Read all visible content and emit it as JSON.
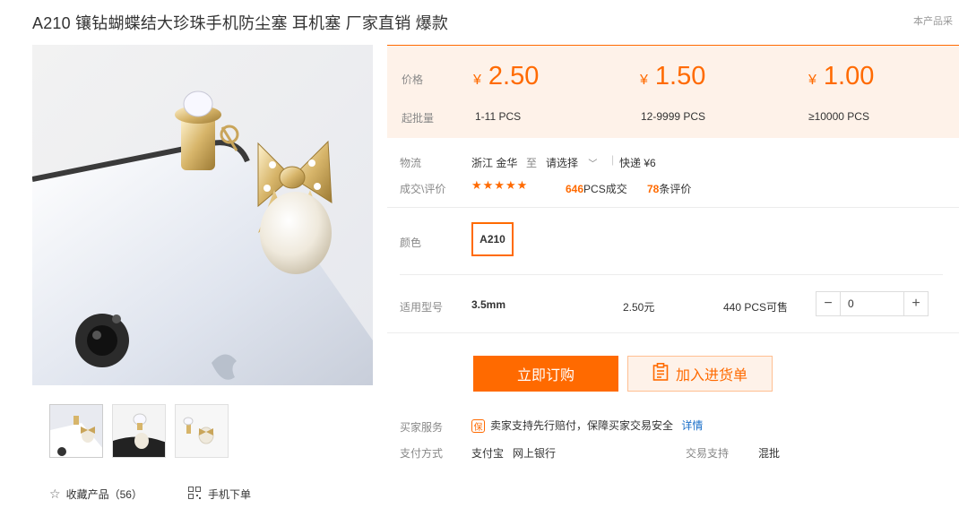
{
  "product": {
    "title": "A210 镶钻蝴蝶结大珍珠手机防尘塞 耳机塞 厂家直销 爆款",
    "corner_note": "本产品采"
  },
  "gallery": {
    "thumb_count": 3,
    "favorite_label": "收藏产品（56）",
    "mobile_order_label": "手机下单"
  },
  "pricing": {
    "price_label": "价格",
    "qty_label": "起批量",
    "currency": "¥",
    "tiers": [
      {
        "price": "2.50",
        "qty": "1-11  PCS"
      },
      {
        "price": "1.50",
        "qty": "12-9999  PCS"
      },
      {
        "price": "1.00",
        "qty": "≥10000  PCS"
      }
    ]
  },
  "logistics": {
    "label": "物流",
    "origin": "浙江 金华",
    "to": "至",
    "select": "请选择",
    "express": "快递 ¥6"
  },
  "reviews": {
    "label": "成交\\评价",
    "stars": "★★★★★",
    "deals_count": "646",
    "deals_suffix": "PCS成交",
    "review_count": "78",
    "review_suffix": "条评价"
  },
  "color": {
    "label": "颜色",
    "selected": "A210"
  },
  "model_row": {
    "label": "适用型号",
    "model": "3.5mm",
    "unit_price": "2.50元",
    "stock": "440 PCS可售",
    "minus": "−",
    "plus": "+",
    "quantity": "0"
  },
  "actions": {
    "buy_now": "立即订购",
    "add_to_list": "加入进货单"
  },
  "service": {
    "buyer_label": "买家服务",
    "badge": "保",
    "buyer_text": "卖家支持先行赔付，保障买家交易安全",
    "details_link": "详情",
    "pay_label": "支付方式",
    "pay_methods": "支付宝   网上银行",
    "trade_label": "交易支持",
    "trade_value": "混批"
  },
  "colors": {
    "accent": "#ff6a00",
    "price_bg": "#fef2e9",
    "link": "#1a6fc9"
  }
}
